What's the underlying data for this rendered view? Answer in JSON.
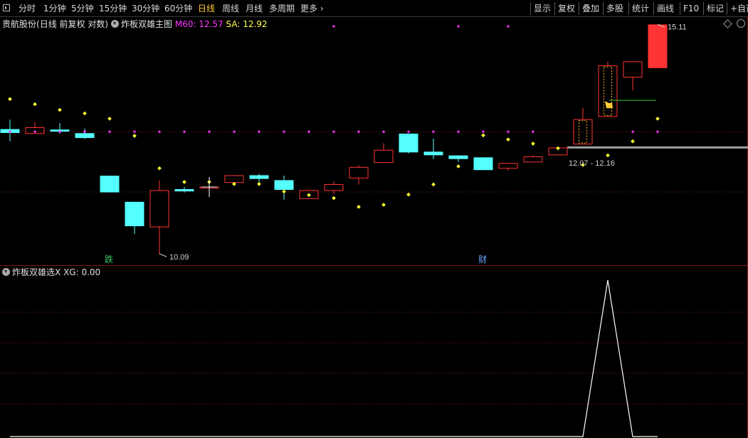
{
  "toolbar": {
    "left_items": [
      {
        "label": "分时",
        "active": false
      },
      {
        "label": "1分钟",
        "active": false
      },
      {
        "label": "5分钟",
        "active": false
      },
      {
        "label": "15分钟",
        "active": false
      },
      {
        "label": "30分钟",
        "active": false
      },
      {
        "label": "60分钟",
        "active": false
      },
      {
        "label": "日线",
        "active": true
      },
      {
        "label": "周线",
        "active": false
      },
      {
        "label": "月线",
        "active": false
      },
      {
        "label": "多周期",
        "active": false
      },
      {
        "label": "更多",
        "active": false
      }
    ],
    "right_items": [
      "显示",
      "复权",
      "叠加",
      "多股",
      "统计",
      "画线",
      "F10",
      "标记",
      "+自选"
    ]
  },
  "main_panel": {
    "stock_name": "贵航股份",
    "chart_mode": "(日线 前复权 对数)",
    "indicator": "炸板双雄主图",
    "m60_text": "M60: 12.57",
    "sa_text": "SA: 12.92",
    "high_label": "15.11",
    "low_label": "10.09",
    "range_label": "12.07 - 12.16",
    "badge_die": "跌",
    "badge_cai": "财"
  },
  "sub_panel": {
    "indicator": "炸板双雄选X",
    "xg_text": "XG: 0.00"
  },
  "colors": {
    "up": "#ff3333",
    "down": "#54ffff",
    "m60": "#ff33ff",
    "sa": "#ffff33",
    "grid": "#7a1515",
    "highlight": "#ffaa33"
  },
  "chart_data": {
    "type": "candlestick",
    "y_scale": "log",
    "candles": [
      {
        "o": 12.56,
        "h": 12.78,
        "l": 12.3,
        "c": 12.49
      },
      {
        "o": 12.47,
        "h": 12.72,
        "l": 12.47,
        "c": 12.6
      },
      {
        "o": 12.55,
        "h": 12.7,
        "l": 12.47,
        "c": 12.52
      },
      {
        "o": 12.47,
        "h": 12.58,
        "l": 12.35,
        "c": 12.38
      },
      {
        "o": 11.57,
        "h": 11.57,
        "l": 11.25,
        "c": 11.25
      },
      {
        "o": 11.05,
        "h": 11.05,
        "l": 10.45,
        "c": 10.6
      },
      {
        "o": 10.58,
        "h": 11.48,
        "l": 10.09,
        "c": 11.28
      },
      {
        "o": 11.3,
        "h": 11.35,
        "l": 11.24,
        "c": 11.27
      },
      {
        "o": 11.35,
        "h": 11.55,
        "l": 11.15,
        "c": 11.35
      },
      {
        "o": 11.44,
        "h": 11.59,
        "l": 11.44,
        "c": 11.58
      },
      {
        "o": 11.58,
        "h": 11.62,
        "l": 11.45,
        "c": 11.52
      },
      {
        "o": 11.48,
        "h": 11.58,
        "l": 11.1,
        "c": 11.3
      },
      {
        "o": 11.12,
        "h": 11.3,
        "l": 11.12,
        "c": 11.28
      },
      {
        "o": 11.28,
        "h": 11.46,
        "l": 11.21,
        "c": 11.4
      },
      {
        "o": 11.53,
        "h": 11.79,
        "l": 11.4,
        "c": 11.75
      },
      {
        "o": 11.85,
        "h": 12.26,
        "l": 11.85,
        "c": 12.11
      },
      {
        "o": 12.46,
        "h": 12.46,
        "l": 12.04,
        "c": 12.07
      },
      {
        "o": 12.07,
        "h": 12.36,
        "l": 11.92,
        "c": 12.01
      },
      {
        "o": 11.99,
        "h": 12.0,
        "l": 11.86,
        "c": 11.93
      },
      {
        "o": 11.95,
        "h": 11.95,
        "l": 11.7,
        "c": 11.7
      },
      {
        "o": 11.73,
        "h": 11.83,
        "l": 11.68,
        "c": 11.83
      },
      {
        "o": 11.86,
        "h": 12.0,
        "l": 11.86,
        "c": 11.97
      },
      {
        "o": 12.01,
        "h": 12.16,
        "l": 12.01,
        "c": 12.16
      },
      {
        "o": 12.24,
        "h": 13.05,
        "l": 12.24,
        "c": 12.78
      },
      {
        "o": 12.85,
        "h": 14.15,
        "l": 12.85,
        "c": 14.05
      },
      {
        "o": 13.77,
        "h": 14.15,
        "l": 13.45,
        "c": 14.15
      },
      {
        "o": 14.0,
        "h": 15.11,
        "l": 14.0,
        "c": 15.1
      }
    ],
    "m60": [
      12.51,
      12.51,
      12.51,
      12.51,
      12.51,
      12.51,
      12.51,
      12.51,
      12.51,
      12.51,
      12.51,
      12.51,
      12.51,
      12.51,
      12.51,
      12.51,
      12.51,
      12.51,
      12.51,
      12.51,
      12.51,
      12.51,
      null,
      null,
      null,
      12.51,
      12.51
    ],
    "sa": [
      13.25,
      13.13,
      13.0,
      12.92,
      12.8,
      12.42,
      11.73,
      11.45,
      11.45,
      11.41,
      11.41,
      11.26,
      11.19,
      11.13,
      10.96,
      11.0,
      11.2,
      11.4,
      11.77,
      12.43,
      12.34,
      12.25,
      12.15,
      11.8,
      12.0,
      12.3,
      12.8
    ],
    "top_m60": [
      null,
      null,
      null,
      null,
      null,
      null,
      null,
      null,
      null,
      null,
      null,
      null,
      null,
      15.06,
      null,
      null,
      null,
      null,
      15.06,
      null,
      15.06,
      null,
      null,
      null,
      null,
      null,
      null
    ],
    "xg": [
      0,
      0,
      0,
      0,
      0,
      0,
      0,
      0,
      0,
      0,
      0,
      0,
      0,
      0,
      0,
      0,
      0,
      0,
      0,
      0,
      0,
      0,
      0,
      0,
      1,
      0,
      0
    ],
    "highlight_candles": [
      23,
      24
    ],
    "resistance_level": 12.16,
    "die_index": 4,
    "cai_index": 19
  }
}
